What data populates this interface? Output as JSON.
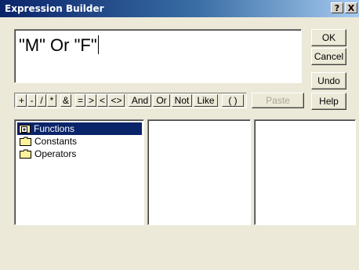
{
  "window": {
    "title": "Expression Builder"
  },
  "titlebar": {
    "help": "?",
    "close": "X"
  },
  "expression": {
    "text": "\"M\" Or \"F\""
  },
  "buttons": {
    "ok": "OK",
    "cancel": "Cancel",
    "undo": "Undo",
    "help": "Help",
    "paste": "Paste"
  },
  "operators": [
    "+",
    "-",
    "/",
    "*",
    "&",
    "=",
    ">",
    "<",
    "<>",
    "And",
    "Or",
    "Not",
    "Like",
    "( )"
  ],
  "tree": [
    {
      "label": "Functions",
      "icon": "expand-plus-folder-icon",
      "selected": true
    },
    {
      "label": "Constants",
      "icon": "folder-icon",
      "selected": false
    },
    {
      "label": "Operators",
      "icon": "folder-icon",
      "selected": false
    }
  ],
  "colors": {
    "title_start": "#0a246a",
    "title_end": "#a6caf0",
    "selection": "#0a246a",
    "dialog_bg": "#ece9d8"
  }
}
